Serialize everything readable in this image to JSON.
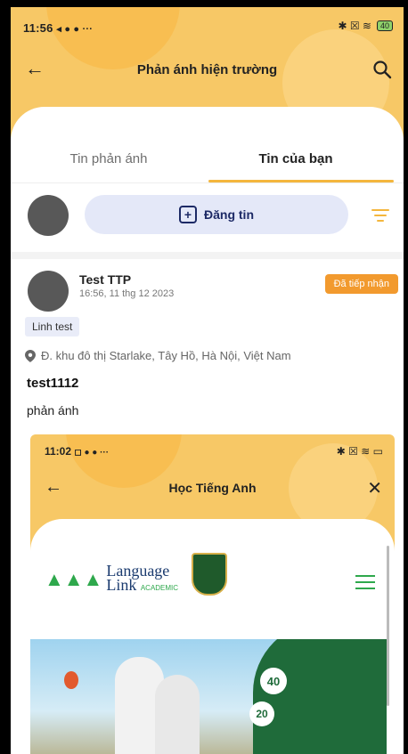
{
  "status_bar": {
    "time": "11:56",
    "extras": "◂ ● ● ···",
    "right": "✱ ☒ ≋",
    "battery": "40"
  },
  "header": {
    "title": "Phản ánh hiện trường"
  },
  "tabs": [
    {
      "label": "Tin phản ánh",
      "active": false
    },
    {
      "label": "Tin của bạn",
      "active": true
    }
  ],
  "compose": {
    "button_label": "Đăng tin"
  },
  "post": {
    "author": "Test TTP",
    "time": "16:56, 11 thg 12 2023",
    "status": "Đã tiếp nhận",
    "tag": "Linh test",
    "location": "Đ. khu đô thị Starlake, Tây Hồ, Hà Nội, Việt Nam",
    "title": "test1112",
    "body": "phản ánh"
  },
  "embedded_screenshot": {
    "status_time": "11:02",
    "status_extras": "◻ ● ● ···",
    "status_right": "✱ ☒ ≋ ▭",
    "title": "Học Tiếng Anh",
    "logo_text": "Language",
    "logo_text2": "Link",
    "logo_sub": "ACADEMIC",
    "badge_a": "40",
    "badge_b": "20"
  },
  "colors": {
    "brand_yellow": "#f7c866",
    "accent_orange": "#f29a2e",
    "navy": "#1d2a66"
  }
}
